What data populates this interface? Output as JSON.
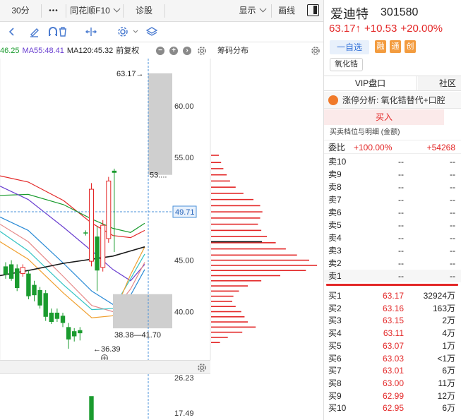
{
  "toolbar": {
    "period": "30分",
    "more": "•••",
    "f10": "同花顺F10",
    "diagnose": "诊股",
    "display": "显示",
    "draw_line": "画线"
  },
  "ma_line": {
    "ma_partial": "46.25",
    "ma55": "MA55:48.41",
    "ma120": "MA120:45.32",
    "adjust": "前复权"
  },
  "chip_panel": {
    "title": "筹码分布"
  },
  "colors": {
    "up": "#e32727",
    "down": "#1a9b2e",
    "price_line": "#4a90d9",
    "ma_black": "#1a1a1a"
  },
  "chart_data": {
    "type": "candlestick",
    "ylim": [
      35.3,
      64.6
    ],
    "y_ticks": [
      "60.00",
      "55.00",
      "50.00",
      "45.00",
      "40.00"
    ],
    "current_price_label": "49.71",
    "high_label": "63.17",
    "low_label": "36.39",
    "zone_label": "38.38—41.70",
    "truncated_label": "53....",
    "candles": [
      {
        "o": 44.4,
        "c": 43.6,
        "h": 44.8,
        "l": 43.2
      },
      {
        "o": 44.6,
        "c": 43.2,
        "h": 45.0,
        "l": 43.0
      },
      {
        "o": 44.2,
        "c": 42.3,
        "h": 44.6,
        "l": 42.0
      },
      {
        "o": 43.7,
        "c": 44.3,
        "h": 44.6,
        "l": 43.4
      },
      {
        "o": 43.7,
        "c": 41.5,
        "h": 44.0,
        "l": 41.2
      },
      {
        "o": 42.6,
        "c": 41.6,
        "h": 43.0,
        "l": 41.0
      },
      {
        "o": 42.1,
        "c": 40.6,
        "h": 42.4,
        "l": 40.3
      },
      {
        "o": 41.8,
        "c": 39.5,
        "h": 42.1,
        "l": 39.1
      },
      {
        "o": 39.9,
        "c": 39.0,
        "h": 40.3,
        "l": 38.8
      },
      {
        "o": 39.9,
        "c": 39.3,
        "h": 40.3,
        "l": 39.0
      },
      {
        "o": 39.6,
        "c": 38.9,
        "h": 39.9,
        "l": 38.5
      },
      {
        "o": 38.5,
        "c": 37.3,
        "h": 38.9,
        "l": 36.4
      },
      {
        "o": 38.1,
        "c": 37.6,
        "h": 38.4,
        "l": 37.1
      },
      {
        "o": 38.2,
        "c": 37.9,
        "h": 38.5,
        "l": 37.2
      },
      {
        "o": 47.7,
        "c": 47.6,
        "h": 47.9,
        "l": 47.4
      },
      {
        "o": 44.9,
        "c": 51.9,
        "h": 52.5,
        "l": 44.4
      },
      {
        "o": 47.3,
        "c": 44.0,
        "h": 48.3,
        "l": 42.0
      },
      {
        "o": 44.3,
        "c": 48.4,
        "h": 48.9,
        "l": 43.9
      },
      {
        "o": 47.1,
        "c": 52.7,
        "h": 53.1,
        "l": 46.7
      },
      {
        "o": 53.7,
        "c": 53.5,
        "h": 53.9,
        "l": 45.8
      }
    ],
    "chip_levels": [
      {
        "p": 55.2,
        "v": 0.07
      },
      {
        "p": 54.5,
        "v": 0.09
      },
      {
        "p": 53.9,
        "v": 0.11
      },
      {
        "p": 53.3,
        "v": 0.14
      },
      {
        "p": 52.7,
        "v": 0.17
      },
      {
        "p": 52.1,
        "v": 0.22
      },
      {
        "p": 51.5,
        "v": 0.29
      },
      {
        "p": 50.9,
        "v": 0.38
      },
      {
        "p": 50.3,
        "v": 0.44
      },
      {
        "p": 49.7,
        "v": 0.46
      },
      {
        "p": 49.1,
        "v": 0.44
      },
      {
        "p": 48.5,
        "v": 0.42
      },
      {
        "p": 47.9,
        "v": 0.45
      },
      {
        "p": 47.3,
        "v": 0.5
      },
      {
        "p": 46.7,
        "v": 0.58
      },
      {
        "p": 46.1,
        "v": 0.67
      },
      {
        "p": 45.5,
        "v": 0.77
      },
      {
        "p": 45.0,
        "v": 0.88
      },
      {
        "p": 44.5,
        "v": 0.95
      },
      {
        "p": 44.0,
        "v": 0.85
      },
      {
        "p": 43.5,
        "v": 0.62
      },
      {
        "p": 43.0,
        "v": 0.45
      },
      {
        "p": 42.5,
        "v": 0.33
      },
      {
        "p": 42.0,
        "v": 0.25
      },
      {
        "p": 41.5,
        "v": 0.2
      },
      {
        "p": 41.0,
        "v": 0.19
      },
      {
        "p": 40.5,
        "v": 0.22
      },
      {
        "p": 40.0,
        "v": 0.27
      },
      {
        "p": 39.5,
        "v": 0.3
      },
      {
        "p": 39.0,
        "v": 0.33
      },
      {
        "p": 38.5,
        "v": 0.4
      },
      {
        "p": 38.0,
        "v": 0.28
      },
      {
        "p": 37.5,
        "v": 0.15
      },
      {
        "p": 37.0,
        "v": 0.08
      }
    ],
    "volume": {
      "y_ticks": [
        "26.23",
        "17.49"
      ],
      "bars": [
        {
          "i": 15,
          "v": 25.5,
          "up": false
        },
        {
          "i": 16,
          "v": 13.2,
          "up": false
        },
        {
          "i": 17,
          "v": 10.8,
          "up": false
        },
        {
          "i": 18,
          "v": 11.8,
          "up": true
        }
      ]
    }
  },
  "stock": {
    "name": "爱迪特",
    "code": "301580",
    "price": "63.17↑",
    "change": "+10.53",
    "change_pct": "+20.00%",
    "watch_label": "一自选",
    "tags": [
      "融",
      "通",
      "创"
    ],
    "concept": "氧化锆"
  },
  "tabs": {
    "vip": "VIP盘口",
    "community": "社区"
  },
  "analysis": {
    "text": "涨停分析: 氧化锆替代+口腔"
  },
  "buy_button": "买入",
  "order_book": {
    "title": "买卖档位与明细 (金额)",
    "weibi_label": "委比",
    "weibi_pct": "+100.00%",
    "weibi_diff": "+54268",
    "asks": [
      {
        "label": "卖10",
        "price": "--",
        "vol": "--"
      },
      {
        "label": "卖9",
        "price": "--",
        "vol": "--"
      },
      {
        "label": "卖8",
        "price": "--",
        "vol": "--"
      },
      {
        "label": "卖7",
        "price": "--",
        "vol": "--"
      },
      {
        "label": "卖6",
        "price": "--",
        "vol": "--"
      },
      {
        "label": "卖5",
        "price": "--",
        "vol": "--"
      },
      {
        "label": "卖4",
        "price": "--",
        "vol": "--"
      },
      {
        "label": "卖3",
        "price": "--",
        "vol": "--"
      },
      {
        "label": "卖2",
        "price": "--",
        "vol": "--"
      },
      {
        "label": "卖1",
        "price": "--",
        "vol": "--"
      }
    ],
    "bids": [
      {
        "label": "买1",
        "price": "63.17",
        "vol": "32924万"
      },
      {
        "label": "买2",
        "price": "63.16",
        "vol": "163万"
      },
      {
        "label": "买3",
        "price": "63.15",
        "vol": "2万"
      },
      {
        "label": "买4",
        "price": "63.11",
        "vol": "4万"
      },
      {
        "label": "买5",
        "price": "63.07",
        "vol": "1万"
      },
      {
        "label": "买6",
        "price": "63.03",
        "vol": "<1万"
      },
      {
        "label": "买7",
        "price": "63.01",
        "vol": "6万"
      },
      {
        "label": "买8",
        "price": "63.00",
        "vol": "11万"
      },
      {
        "label": "买9",
        "price": "62.99",
        "vol": "12万"
      },
      {
        "label": "买10",
        "price": "62.95",
        "vol": "6万"
      }
    ]
  }
}
